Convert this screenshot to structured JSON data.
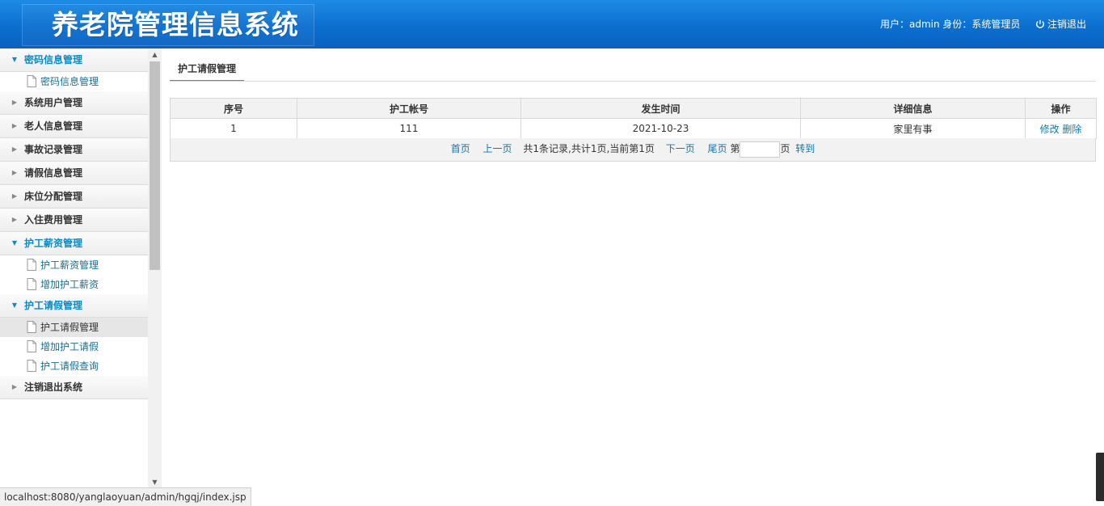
{
  "header": {
    "logo": "养老院管理信息系统",
    "user_info": "用户：admin 身份：系统管理员",
    "logout": "注销退出"
  },
  "sidebar": {
    "groups": [
      {
        "label": "密码信息管理",
        "open": true,
        "items": [
          "密码信息管理"
        ]
      },
      {
        "label": "系统用户管理",
        "open": false
      },
      {
        "label": "老人信息管理",
        "open": false
      },
      {
        "label": "事故记录管理",
        "open": false
      },
      {
        "label": "请假信息管理",
        "open": false
      },
      {
        "label": "床位分配管理",
        "open": false
      },
      {
        "label": "入住费用管理",
        "open": false
      },
      {
        "label": "护工薪资管理",
        "open": true,
        "items": [
          "护工薪资管理",
          "增加护工薪资"
        ]
      },
      {
        "label": "护工请假管理",
        "open": true,
        "items": [
          "护工请假管理",
          "增加护工请假",
          "护工请假查询"
        ],
        "active_item": "护工请假管理"
      },
      {
        "label": "注销退出系统",
        "open": false
      }
    ]
  },
  "main": {
    "tab": "护工请假管理",
    "table": {
      "columns": [
        "序号",
        "护工帐号",
        "发生时间",
        "详细信息",
        "操作"
      ],
      "rows": [
        {
          "no": "1",
          "account": "111",
          "time": "2021-10-23",
          "detail": "家里有事",
          "edit": "修改",
          "delete": "删除"
        }
      ]
    },
    "pager": {
      "first": "首页",
      "prev": "上一页",
      "summary": "共1条记录,共计1页,当前第1页",
      "next": "下一页",
      "last": "尾页",
      "page_prefix": "第",
      "page_suffix": "页",
      "page_value": "",
      "go": "转到"
    }
  },
  "status_bar": "localhost:8080/yanglaoyuan/admin/hgqj/index.jsp",
  "colors": {
    "header_blue": "#0b6fd0",
    "menu_open": "#0a8bc6",
    "link": "#1677a8",
    "tab_underline": "#e45c1b"
  }
}
